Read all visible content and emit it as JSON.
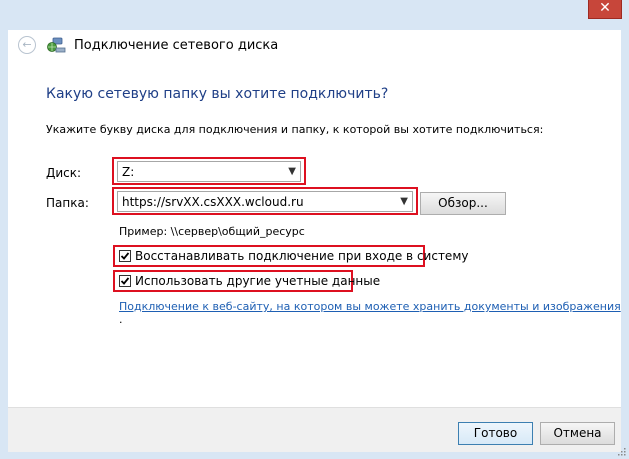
{
  "window": {
    "close_glyph": "✕",
    "back_glyph": "←",
    "title": "Подключение сетевого диска"
  },
  "main": {
    "heading": "Какую сетевую папку вы хотите подключить?",
    "instruction": "Укажите букву диска для подключения и папку, к которой вы хотите подключиться:",
    "drive_label": "Диск:",
    "drive_value": "Z:",
    "folder_label": "Папка:",
    "folder_value": "https://srvXX.csXXX.wcloud.ru",
    "browse_label": "Обзор...",
    "example": "Пример: \\\\сервер\\общий_ресурс",
    "reconnect_label": "Восстанавливать подключение при входе в систему",
    "reconnect_checked": true,
    "other_credentials_label": "Использовать другие учетные данные",
    "other_credentials_checked": true,
    "website_link": "Подключение к веб-сайту, на котором вы можете хранить документы и изображения",
    "website_link_suffix": "."
  },
  "footer": {
    "finish_label": "Готово",
    "cancel_label": "Отмена"
  },
  "colors": {
    "highlight": "#dd1020",
    "heading": "#1f3f87",
    "link": "#1e5fb3",
    "close": "#c7463a"
  }
}
